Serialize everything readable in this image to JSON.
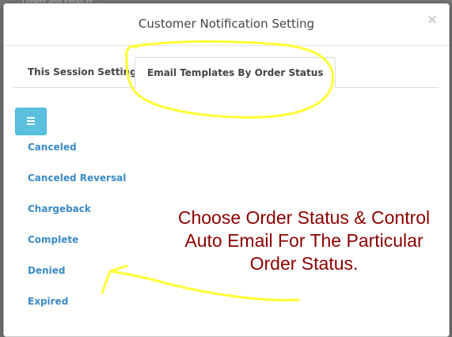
{
  "background": {
    "partial_text": "Orders and Email Fr..."
  },
  "modal": {
    "title": "Customer Notification Setting",
    "close_label": "×"
  },
  "tabs": [
    {
      "label": "This Session Setting",
      "active": false
    },
    {
      "label": "Email Templates By Order Status",
      "active": true
    }
  ],
  "menu_button": {
    "icon": "hamburger-icon",
    "color": "#5bc0de"
  },
  "order_statuses": [
    {
      "label": "Canceled"
    },
    {
      "label": "Canceled Reversal"
    },
    {
      "label": "Chargeback"
    },
    {
      "label": "Complete"
    },
    {
      "label": "Denied"
    },
    {
      "label": "Expired"
    }
  ],
  "annotation": {
    "lines": [
      "Choose Order Status & Control",
      "Auto Email For The Particular",
      "Order Status."
    ],
    "color": "#8b0000",
    "highlight_color": "#ffff33"
  }
}
